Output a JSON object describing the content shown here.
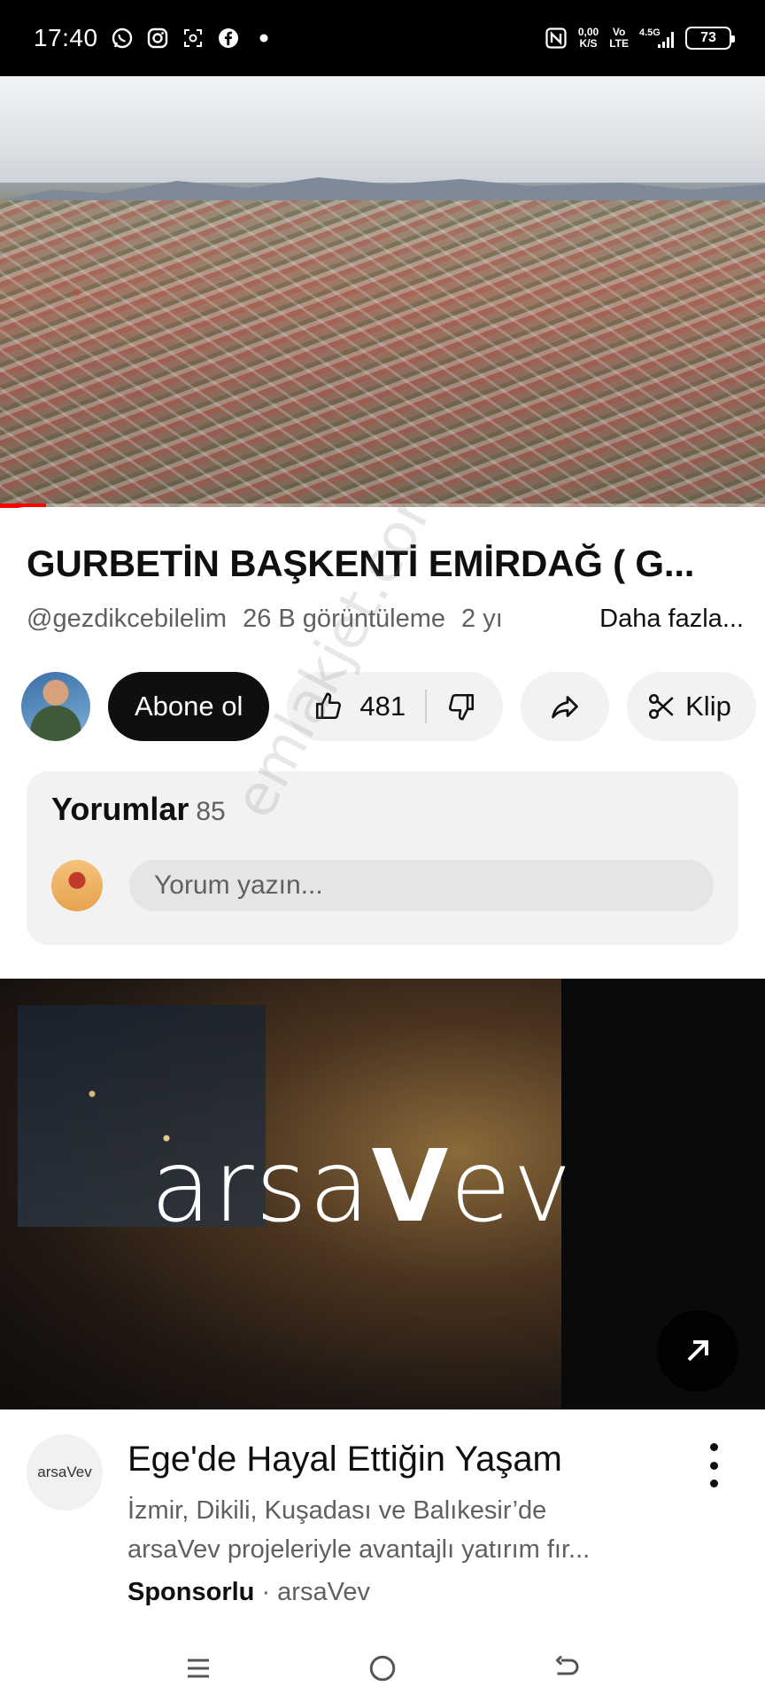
{
  "status_bar": {
    "time": "17:40",
    "net_speed_value": "0,00",
    "net_speed_unit": "K/S",
    "volte_top": "Vo",
    "volte_bottom": "LTE",
    "network": "4.5G",
    "battery": "73",
    "left_icons": [
      "whatsapp-icon",
      "instagram-icon",
      "screenshot-icon",
      "facebook-icon",
      "dot-icon"
    ]
  },
  "video": {
    "progress": 0.06
  },
  "video_info": {
    "title": "GURBETİN BAŞKENTİ EMİRDAĞ ( G...",
    "channel_handle": "@gezdikcebilelim",
    "views": "26 B görüntüleme",
    "age": "2 yı",
    "more_label": "Daha fazla..."
  },
  "actions": {
    "subscribe_label": "Abone ol",
    "like_count": "481",
    "clip_label": "Klip"
  },
  "comments": {
    "title": "Yorumlar",
    "count": "85",
    "placeholder": "Yorum yazın..."
  },
  "ad": {
    "logo_left": "arsa",
    "logo_v": "V",
    "logo_right": "ev",
    "avatar_text": "arsaVev",
    "title": "Ege'de Hayal Ettiğin Yaşam",
    "desc_line1": "İzmir, Dikili, Kuşadası ve Balıkesir’de",
    "desc_line2": "arsaVev projeleriyle avantajlı yatırım fır...",
    "sponsored": "Sponsorlu",
    "separator": " · ",
    "advertiser": "arsaVev"
  },
  "watermark": "emlakjet.com",
  "colors": {
    "accent_red": "#ff0000",
    "text_primary": "#0f0f0f",
    "text_secondary": "#606060",
    "pill_bg": "#f2f2f2"
  }
}
